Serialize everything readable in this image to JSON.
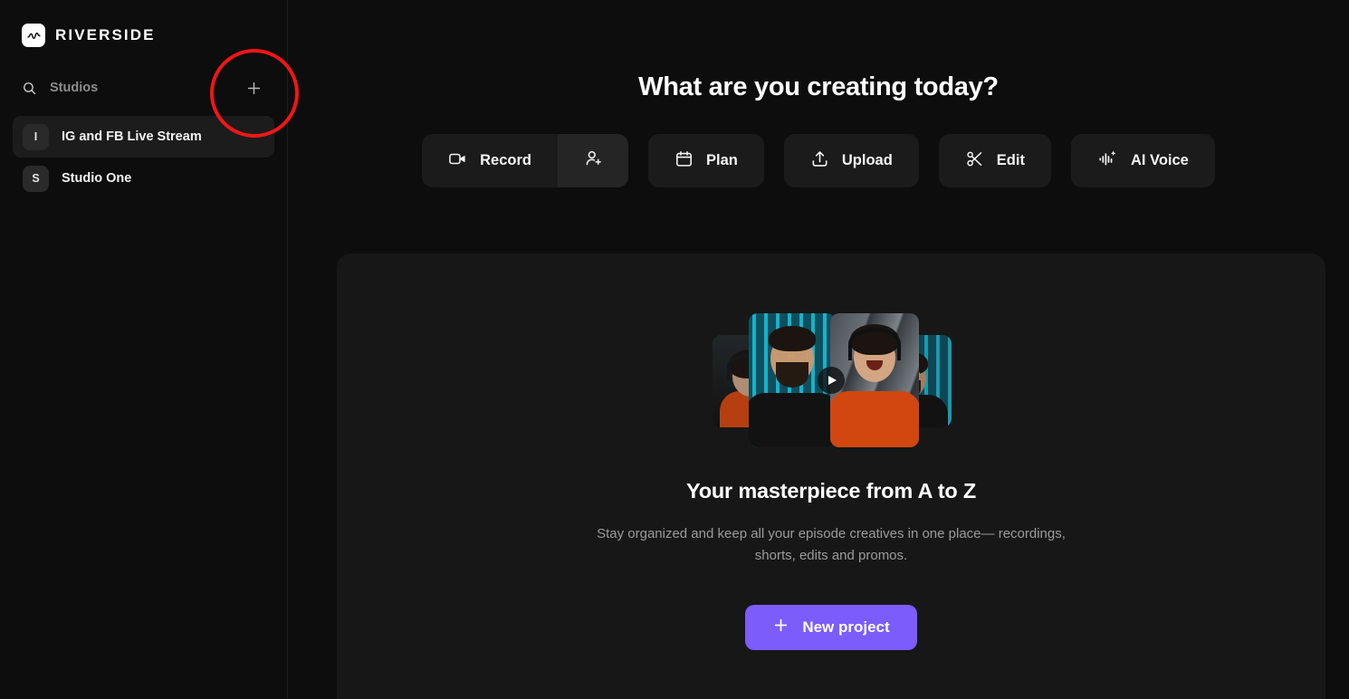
{
  "brand": {
    "name": "RIVERSIDE",
    "logo_icon": "waveform-logo-icon",
    "logo_bg": "#ffffff"
  },
  "sidebar": {
    "search": {
      "icon": "search-icon",
      "placeholder": "Studios",
      "value": ""
    },
    "add_studio": {
      "icon": "plus-icon",
      "label": "+"
    },
    "items": [
      {
        "initial": "I",
        "label": "IG and FB Live Stream",
        "active": true
      },
      {
        "initial": "S",
        "label": "Studio One",
        "active": false
      }
    ]
  },
  "main": {
    "headline": "What are you creating today?",
    "actions": [
      {
        "label": "Record",
        "icon": "video-camera-icon",
        "has_invite": true,
        "invite_icon": "person-add-icon"
      },
      {
        "label": "Plan",
        "icon": "calendar-icon"
      },
      {
        "label": "Upload",
        "icon": "upload-icon"
      },
      {
        "label": "Edit",
        "icon": "scissors-icon"
      },
      {
        "label": "AI Voice",
        "icon": "waveform-sparkle-icon"
      }
    ],
    "card": {
      "media": {
        "icon": "play-button-icon",
        "alt": "video thumbnail of three people recording a podcast"
      },
      "title": "Your masterpiece from A to Z",
      "subtitle_line1": "Stay organized and keep all your episode creatives in one place—",
      "subtitle_line2": "recordings, shorts, edits and promos.",
      "cta": {
        "label": "New project",
        "icon": "plus-icon",
        "color": "#7c5cfa"
      }
    }
  },
  "annotation": {
    "shape": "circle",
    "color": "#f11616",
    "target": "add-studio-button"
  }
}
